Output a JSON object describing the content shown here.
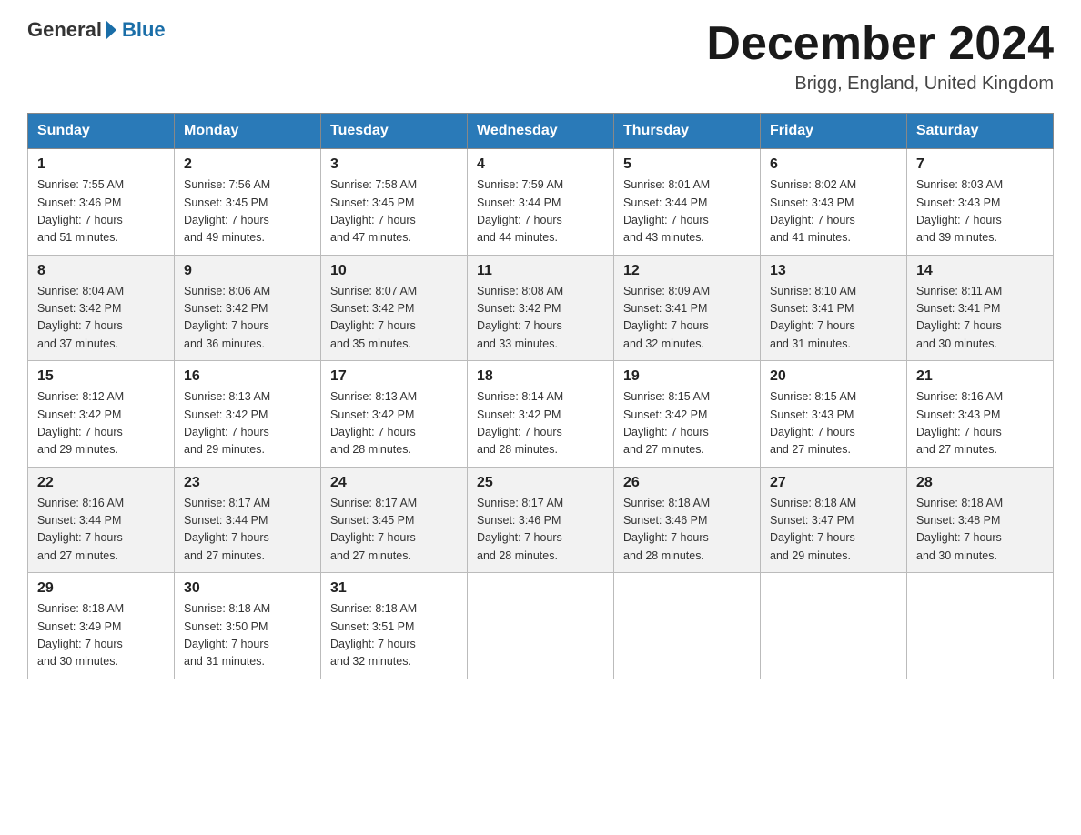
{
  "header": {
    "logo_general": "General",
    "logo_blue": "Blue",
    "month_title": "December 2024",
    "location": "Brigg, England, United Kingdom"
  },
  "days_of_week": [
    "Sunday",
    "Monday",
    "Tuesday",
    "Wednesday",
    "Thursday",
    "Friday",
    "Saturday"
  ],
  "weeks": [
    [
      {
        "day": "1",
        "info": "Sunrise: 7:55 AM\nSunset: 3:46 PM\nDaylight: 7 hours\nand 51 minutes."
      },
      {
        "day": "2",
        "info": "Sunrise: 7:56 AM\nSunset: 3:45 PM\nDaylight: 7 hours\nand 49 minutes."
      },
      {
        "day": "3",
        "info": "Sunrise: 7:58 AM\nSunset: 3:45 PM\nDaylight: 7 hours\nand 47 minutes."
      },
      {
        "day": "4",
        "info": "Sunrise: 7:59 AM\nSunset: 3:44 PM\nDaylight: 7 hours\nand 44 minutes."
      },
      {
        "day": "5",
        "info": "Sunrise: 8:01 AM\nSunset: 3:44 PM\nDaylight: 7 hours\nand 43 minutes."
      },
      {
        "day": "6",
        "info": "Sunrise: 8:02 AM\nSunset: 3:43 PM\nDaylight: 7 hours\nand 41 minutes."
      },
      {
        "day": "7",
        "info": "Sunrise: 8:03 AM\nSunset: 3:43 PM\nDaylight: 7 hours\nand 39 minutes."
      }
    ],
    [
      {
        "day": "8",
        "info": "Sunrise: 8:04 AM\nSunset: 3:42 PM\nDaylight: 7 hours\nand 37 minutes."
      },
      {
        "day": "9",
        "info": "Sunrise: 8:06 AM\nSunset: 3:42 PM\nDaylight: 7 hours\nand 36 minutes."
      },
      {
        "day": "10",
        "info": "Sunrise: 8:07 AM\nSunset: 3:42 PM\nDaylight: 7 hours\nand 35 minutes."
      },
      {
        "day": "11",
        "info": "Sunrise: 8:08 AM\nSunset: 3:42 PM\nDaylight: 7 hours\nand 33 minutes."
      },
      {
        "day": "12",
        "info": "Sunrise: 8:09 AM\nSunset: 3:41 PM\nDaylight: 7 hours\nand 32 minutes."
      },
      {
        "day": "13",
        "info": "Sunrise: 8:10 AM\nSunset: 3:41 PM\nDaylight: 7 hours\nand 31 minutes."
      },
      {
        "day": "14",
        "info": "Sunrise: 8:11 AM\nSunset: 3:41 PM\nDaylight: 7 hours\nand 30 minutes."
      }
    ],
    [
      {
        "day": "15",
        "info": "Sunrise: 8:12 AM\nSunset: 3:42 PM\nDaylight: 7 hours\nand 29 minutes."
      },
      {
        "day": "16",
        "info": "Sunrise: 8:13 AM\nSunset: 3:42 PM\nDaylight: 7 hours\nand 29 minutes."
      },
      {
        "day": "17",
        "info": "Sunrise: 8:13 AM\nSunset: 3:42 PM\nDaylight: 7 hours\nand 28 minutes."
      },
      {
        "day": "18",
        "info": "Sunrise: 8:14 AM\nSunset: 3:42 PM\nDaylight: 7 hours\nand 28 minutes."
      },
      {
        "day": "19",
        "info": "Sunrise: 8:15 AM\nSunset: 3:42 PM\nDaylight: 7 hours\nand 27 minutes."
      },
      {
        "day": "20",
        "info": "Sunrise: 8:15 AM\nSunset: 3:43 PM\nDaylight: 7 hours\nand 27 minutes."
      },
      {
        "day": "21",
        "info": "Sunrise: 8:16 AM\nSunset: 3:43 PM\nDaylight: 7 hours\nand 27 minutes."
      }
    ],
    [
      {
        "day": "22",
        "info": "Sunrise: 8:16 AM\nSunset: 3:44 PM\nDaylight: 7 hours\nand 27 minutes."
      },
      {
        "day": "23",
        "info": "Sunrise: 8:17 AM\nSunset: 3:44 PM\nDaylight: 7 hours\nand 27 minutes."
      },
      {
        "day": "24",
        "info": "Sunrise: 8:17 AM\nSunset: 3:45 PM\nDaylight: 7 hours\nand 27 minutes."
      },
      {
        "day": "25",
        "info": "Sunrise: 8:17 AM\nSunset: 3:46 PM\nDaylight: 7 hours\nand 28 minutes."
      },
      {
        "day": "26",
        "info": "Sunrise: 8:18 AM\nSunset: 3:46 PM\nDaylight: 7 hours\nand 28 minutes."
      },
      {
        "day": "27",
        "info": "Sunrise: 8:18 AM\nSunset: 3:47 PM\nDaylight: 7 hours\nand 29 minutes."
      },
      {
        "day": "28",
        "info": "Sunrise: 8:18 AM\nSunset: 3:48 PM\nDaylight: 7 hours\nand 30 minutes."
      }
    ],
    [
      {
        "day": "29",
        "info": "Sunrise: 8:18 AM\nSunset: 3:49 PM\nDaylight: 7 hours\nand 30 minutes."
      },
      {
        "day": "30",
        "info": "Sunrise: 8:18 AM\nSunset: 3:50 PM\nDaylight: 7 hours\nand 31 minutes."
      },
      {
        "day": "31",
        "info": "Sunrise: 8:18 AM\nSunset: 3:51 PM\nDaylight: 7 hours\nand 32 minutes."
      },
      {
        "day": "",
        "info": ""
      },
      {
        "day": "",
        "info": ""
      },
      {
        "day": "",
        "info": ""
      },
      {
        "day": "",
        "info": ""
      }
    ]
  ],
  "colors": {
    "header_bg": "#2a7ab8",
    "header_text": "#ffffff",
    "border": "#888888",
    "accent_blue": "#1a6ea8"
  }
}
